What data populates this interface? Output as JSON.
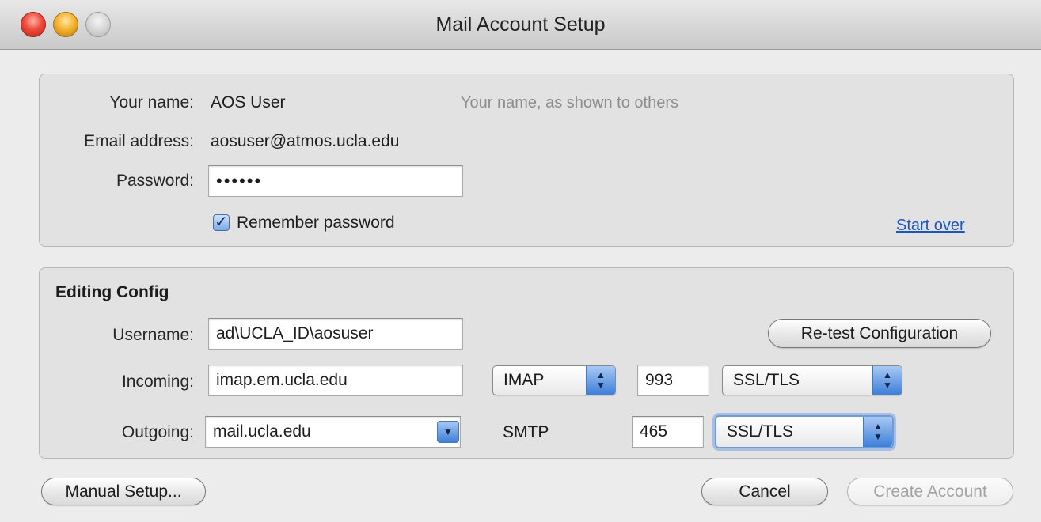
{
  "window": {
    "title": "Mail Account Setup"
  },
  "account": {
    "name_label": "Your name:",
    "name_value": "AOS User",
    "name_hint": "Your name, as shown to others",
    "email_label": "Email address:",
    "email_value": "aosuser@atmos.ucla.edu",
    "password_label": "Password:",
    "password_value": "••••••",
    "remember_label": "Remember password",
    "remember_checked": true,
    "start_over": "Start over"
  },
  "config": {
    "section_title": "Editing Config",
    "username_label": "Username:",
    "username_value": "ad\\UCLA_ID\\aosuser",
    "retest_button": "Re-test Configuration",
    "incoming_label": "Incoming:",
    "incoming_server": "imap.em.ucla.edu",
    "incoming_protocol": "IMAP",
    "incoming_port": "993",
    "incoming_security": "SSL/TLS",
    "outgoing_label": "Outgoing:",
    "outgoing_server": "mail.ucla.edu",
    "outgoing_protocol": "SMTP",
    "outgoing_port": "465",
    "outgoing_security": "SSL/TLS"
  },
  "footer": {
    "manual_setup": "Manual Setup...",
    "cancel": "Cancel",
    "create_account": "Create Account"
  },
  "colors": {
    "accent": "#3d7fd8",
    "link": "#1a55c4",
    "disabled_text": "#a3a3a3"
  }
}
